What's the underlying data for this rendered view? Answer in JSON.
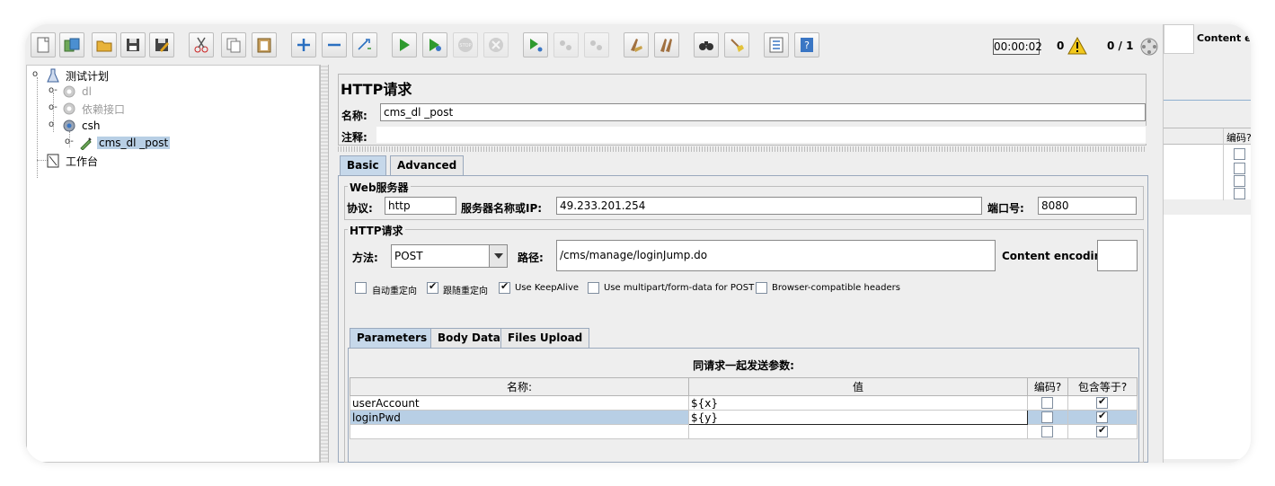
{
  "toolbar": {
    "buttons": [
      "new-icon",
      "templates-icon",
      "open-icon",
      "save-icon",
      "save-as-icon",
      "cut-icon",
      "copy-icon",
      "paste-icon",
      "expand-icon",
      "collapse-icon",
      "toggle-icon",
      "start-icon",
      "start-no-pause-icon",
      "stop-icon",
      "shutdown-icon",
      "remote-start-icon",
      "remote-stop-icon",
      "remote-shutdown-icon",
      "clear-icon",
      "clear-all-icon",
      "search-icon",
      "reset-search-icon",
      "function-helper-icon",
      "help-icon"
    ],
    "timer": "00:00:02",
    "error_count": "0",
    "thread_count": "0 / 1"
  },
  "tree": {
    "items": [
      {
        "label": "测试计划"
      },
      {
        "label": "dl"
      },
      {
        "label": "依赖接口"
      },
      {
        "label": "csh"
      },
      {
        "label": "cms_dl _post"
      },
      {
        "label": "工作台"
      }
    ]
  },
  "sampler": {
    "title": "HTTP请求",
    "name_label": "名称:",
    "name_value": "cms_dl _post",
    "comment_label": "注释:",
    "comment_value": "",
    "tabs": [
      "Basic",
      "Advanced"
    ],
    "server_group": {
      "title": "Web服务器",
      "protocol_label": "协议:",
      "protocol_value": "http",
      "server_label": "服务器名称或IP:",
      "server_value": "49.233.201.254",
      "port_label": "端口号:",
      "port_value": "8080"
    },
    "request_group": {
      "title": "HTTP请求",
      "method_label": "方法:",
      "method_value": "POST",
      "path_label": "路径:",
      "path_value": "/cms/manage/loginJump.do",
      "encoding_label": "Content encoding:",
      "encoding_value": ""
    },
    "options": [
      {
        "label": "自动重定向",
        "checked": false
      },
      {
        "label": "跟随重定向",
        "checked": true
      },
      {
        "label": "Use KeepAlive",
        "checked": true
      },
      {
        "label": "Use multipart/form-data for POST",
        "checked": false
      },
      {
        "label": "Browser-compatible headers",
        "checked": false
      }
    ],
    "param_tabs": [
      "Parameters",
      "Body Data",
      "Files Upload"
    ],
    "params": {
      "caption": "同请求一起发送参数:",
      "headers": [
        "名称:",
        "值",
        "编码?",
        "包含等于?"
      ],
      "rows": [
        {
          "name": "userAccount",
          "value": "${x}",
          "encode": false,
          "include_equals": true
        },
        {
          "name": "loginPwd",
          "value": "${y}",
          "encode": false,
          "include_equals": true
        },
        {
          "name": "",
          "value": "",
          "encode": false,
          "include_equals": true
        }
      ]
    }
  },
  "right_panel": {
    "content_encoding_label": "Content en",
    "encode_header": "编码?"
  }
}
